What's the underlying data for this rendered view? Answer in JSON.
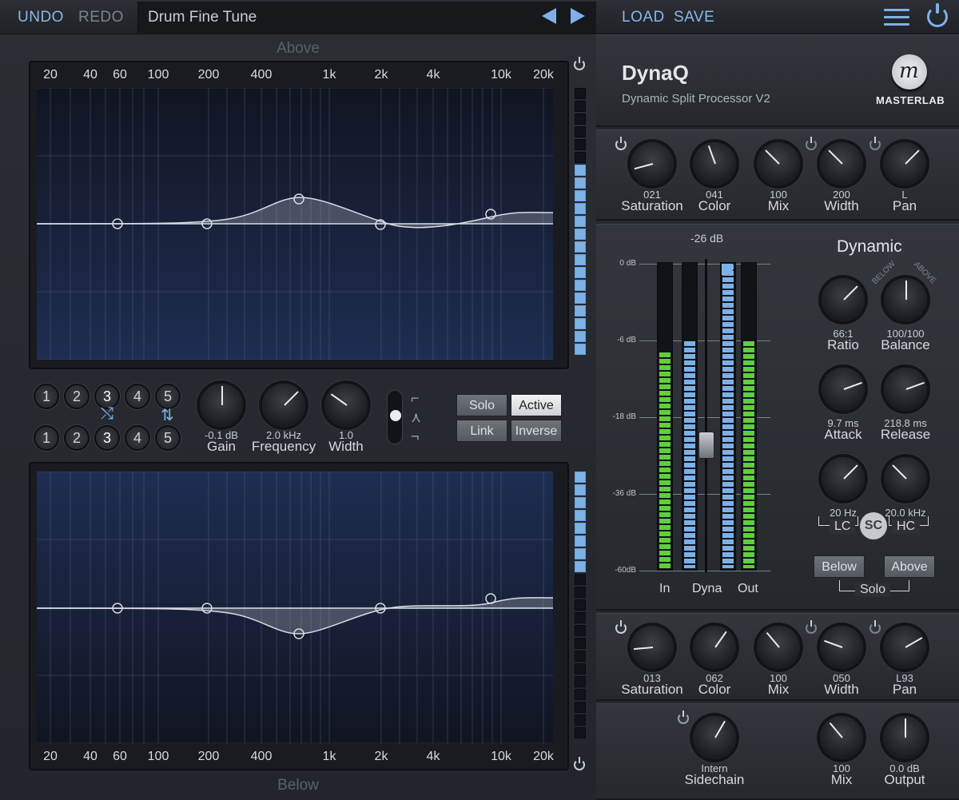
{
  "header": {
    "undo": "UNDO",
    "redo": "REDO",
    "preset": "Drum Fine Tune",
    "load": "LOAD",
    "save": "SAVE"
  },
  "eq": {
    "above_label": "Above",
    "below_label": "Below",
    "freq_ticks": [
      "20",
      "40",
      "60",
      "100",
      "200",
      "400",
      "1k",
      "2k",
      "4k",
      "10k",
      "20k"
    ],
    "bands_top": [
      "1",
      "2",
      "3",
      "4",
      "5"
    ],
    "bands_bottom": [
      "1",
      "2",
      "3",
      "4",
      "5"
    ],
    "gain": {
      "value": "-0.1 dB",
      "label": "Gain"
    },
    "frequency": {
      "value": "2.0 kHz",
      "label": "Frequency"
    },
    "width": {
      "value": "1.0",
      "label": "Width"
    },
    "buttons": {
      "solo": "Solo",
      "active": "Active",
      "link": "Link",
      "inverse": "Inverse"
    }
  },
  "brand": {
    "title": "DynaQ",
    "subtitle": "Dynamic Split Processor V2",
    "logo_text": "MASTERLAB",
    "logo_mark": "m"
  },
  "top_knobs": [
    {
      "value": "021",
      "label": "Saturation"
    },
    {
      "value": "041",
      "label": "Color"
    },
    {
      "value": "100",
      "label": "Mix"
    },
    {
      "value": "200",
      "label": "Width"
    },
    {
      "value": "L",
      "label": "Pan"
    }
  ],
  "meters": {
    "readout": "-26 dB",
    "scale": [
      "0 dB",
      "-6 dB",
      "-18 dB",
      "-36 dB",
      "-60dB"
    ],
    "in_label": "In",
    "dyna_label": "Dyna",
    "out_label": "Out"
  },
  "dynamic": {
    "title": "Dynamic",
    "below_arc": "BELOW",
    "above_arc": "ABOVE",
    "ratio": {
      "value": "66:1",
      "label": "Ratio"
    },
    "balance": {
      "value": "100/100",
      "label": "Balance"
    },
    "attack": {
      "value": "9.7 ms",
      "label": "Attack"
    },
    "release": {
      "value": "218.8 ms",
      "label": "Release"
    },
    "lc": {
      "value": "20 Hz",
      "label": "LC"
    },
    "hc": {
      "value": "20.0 kHz",
      "label": "HC"
    },
    "sc": "SC",
    "below_btn": "Below",
    "above_btn": "Above",
    "solo": "Solo"
  },
  "bottom_knobs": [
    {
      "value": "013",
      "label": "Saturation"
    },
    {
      "value": "062",
      "label": "Color"
    },
    {
      "value": "100",
      "label": "Mix"
    },
    {
      "value": "050",
      "label": "Width"
    },
    {
      "value": "L93",
      "label": "Pan"
    }
  ],
  "output": {
    "sidechain": {
      "value": "Intern",
      "label": "Sidechain"
    },
    "mix": {
      "value": "100",
      "label": "Mix"
    },
    "output": {
      "value": "0.0 dB",
      "label": "Output"
    }
  },
  "colors": {
    "accent": "#7fb0ea",
    "meter_green": "#5ecf3e",
    "meter_blue": "#7cb1e8"
  }
}
